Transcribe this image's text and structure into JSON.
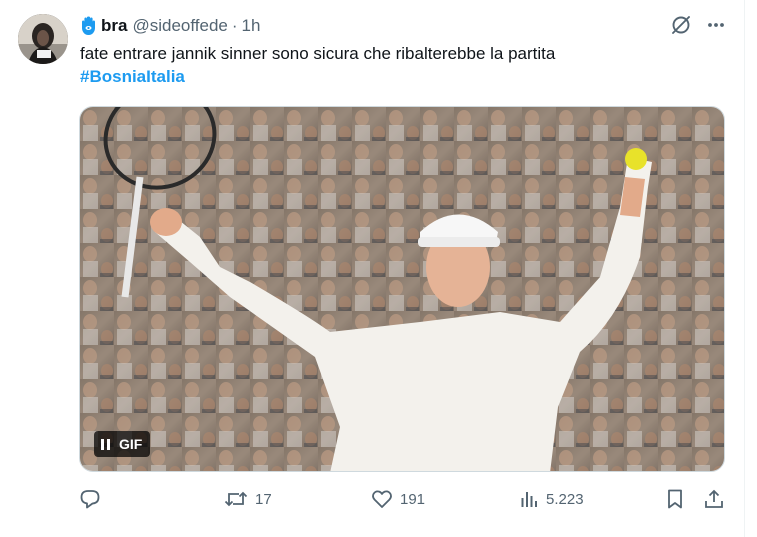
{
  "user": {
    "display_name": "bra",
    "handle": "@sideoffede",
    "separator": "·",
    "time": "1h"
  },
  "tweet": {
    "text": "fate entrare jannik sinner sono sicura che ribalterebbe la partita",
    "hashtag": "#BosniaItalia"
  },
  "media": {
    "badge_label": "GIF"
  },
  "actions": {
    "reply_count": "",
    "retweet_count": "17",
    "like_count": "191",
    "views_count": "5.223"
  },
  "icons": {
    "hamsa": "hamsa-icon",
    "grok": "grok-icon",
    "more": "more-icon",
    "pause": "pause-icon",
    "reply": "reply-icon",
    "retweet": "retweet-icon",
    "like": "like-icon",
    "views": "views-icon",
    "bookmark": "bookmark-icon",
    "share": "share-icon"
  },
  "colors": {
    "text": "#0f1419",
    "secondary": "#536471",
    "hashtag": "#1d9bf0",
    "hamsa": "#1d9bf0"
  }
}
